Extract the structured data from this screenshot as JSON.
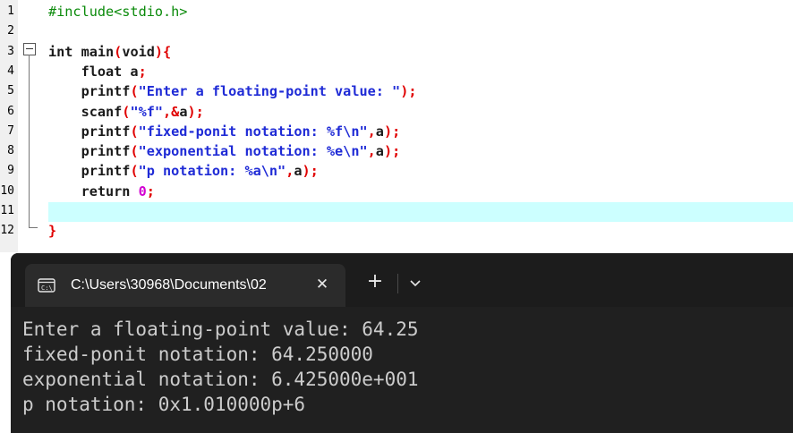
{
  "editor": {
    "line_numbers": [
      "1",
      "2",
      "3",
      "4",
      "5",
      "6",
      "7",
      "8",
      "9",
      "10",
      "11",
      "12"
    ],
    "lines": [
      [
        {
          "t": "#include<stdio.h>",
          "c": "pre"
        }
      ],
      [],
      [
        {
          "t": "int main",
          "c": "plain"
        },
        {
          "t": "(",
          "c": "sym"
        },
        {
          "t": "void",
          "c": "plain"
        },
        {
          "t": "){",
          "c": "sym"
        }
      ],
      [
        {
          "t": "    float a",
          "c": "plain"
        },
        {
          "t": ";",
          "c": "sym"
        }
      ],
      [
        {
          "t": "    printf",
          "c": "plain"
        },
        {
          "t": "(",
          "c": "sym"
        },
        {
          "t": "\"Enter a floating-point value: \"",
          "c": "str"
        },
        {
          "t": ");",
          "c": "sym"
        }
      ],
      [
        {
          "t": "    scanf",
          "c": "plain"
        },
        {
          "t": "(",
          "c": "sym"
        },
        {
          "t": "\"%f\"",
          "c": "str"
        },
        {
          "t": ",&",
          "c": "sym"
        },
        {
          "t": "a",
          "c": "plain"
        },
        {
          "t": ");",
          "c": "sym"
        }
      ],
      [
        {
          "t": "    printf",
          "c": "plain"
        },
        {
          "t": "(",
          "c": "sym"
        },
        {
          "t": "\"fixed-ponit notation: %f\\n\"",
          "c": "str"
        },
        {
          "t": ",",
          "c": "sym"
        },
        {
          "t": "a",
          "c": "plain"
        },
        {
          "t": ");",
          "c": "sym"
        }
      ],
      [
        {
          "t": "    printf",
          "c": "plain"
        },
        {
          "t": "(",
          "c": "sym"
        },
        {
          "t": "\"exponential notation: %e\\n\"",
          "c": "str"
        },
        {
          "t": ",",
          "c": "sym"
        },
        {
          "t": "a",
          "c": "plain"
        },
        {
          "t": ");",
          "c": "sym"
        }
      ],
      [
        {
          "t": "    printf",
          "c": "plain"
        },
        {
          "t": "(",
          "c": "sym"
        },
        {
          "t": "\"p notation: %a\\n\"",
          "c": "str"
        },
        {
          "t": ",",
          "c": "sym"
        },
        {
          "t": "a",
          "c": "plain"
        },
        {
          "t": ");",
          "c": "sym"
        }
      ],
      [
        {
          "t": "    return ",
          "c": "plain"
        },
        {
          "t": "0",
          "c": "num"
        },
        {
          "t": ";",
          "c": "sym"
        }
      ],
      [],
      [
        {
          "t": "}",
          "c": "sym"
        }
      ]
    ],
    "colors": {
      "pre": "#0a8a0a",
      "plain": "#1a1a1a",
      "sym": "#e00000",
      "str": "#1f2bd6",
      "num": "#d200d2",
      "current_line": "#ccffff"
    }
  },
  "terminal": {
    "tab_title": "C:\\Users\\30968\\Documents\\02",
    "tab_icon": "console-icon",
    "close_label": "✕",
    "new_tab_label": "+",
    "output": [
      "Enter a floating-point value: 64.25",
      "fixed-ponit notation: 64.250000",
      "exponential notation: 6.425000e+001",
      "p notation: 0x1.010000p+6"
    ]
  }
}
